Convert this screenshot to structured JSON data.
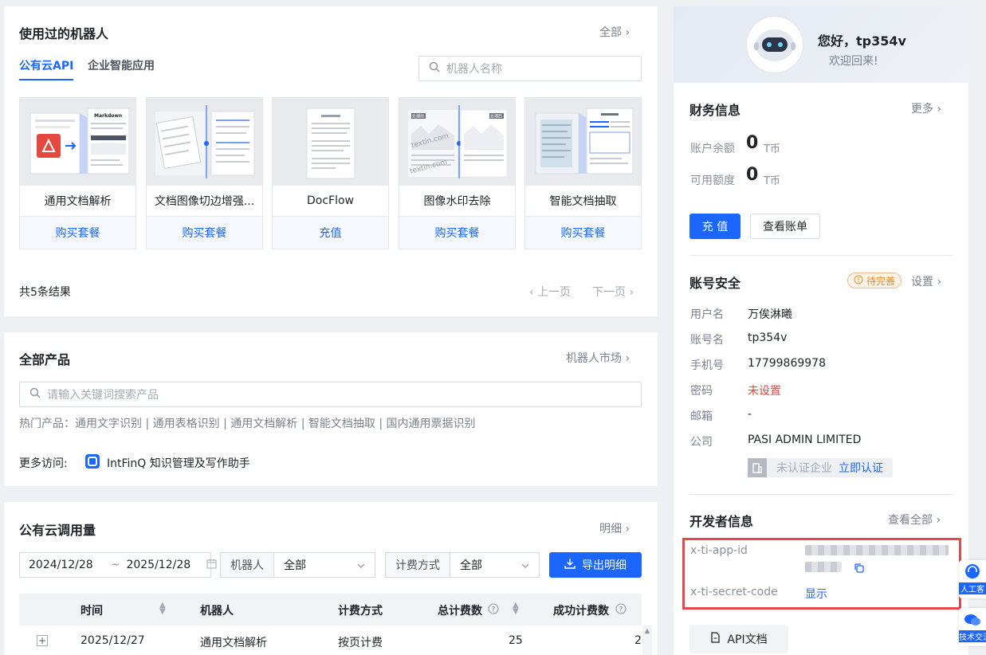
{
  "robots": {
    "title": "使用过的机器人",
    "all_link": "全部",
    "tabs": [
      {
        "label": "公有云API",
        "active": true
      },
      {
        "label": "企业智能应用",
        "active": false
      }
    ],
    "search_placeholder": "机器人名称",
    "items": [
      {
        "name": "通用文档解析",
        "action": "购买套餐"
      },
      {
        "name": "文档图像切边增强...",
        "action": "购买套餐"
      },
      {
        "name": "DocFlow",
        "action": "充值"
      },
      {
        "name": "图像水印去除",
        "action": "购买套餐"
      },
      {
        "name": "智能文档抽取",
        "action": "购买套餐"
      }
    ],
    "thumb_text": {
      "markdown": "Markdown",
      "watermark": "textin.com",
      "tag": "处理前",
      "tag2": "处理后"
    },
    "result_count": "共5条结果",
    "prev": "上一页",
    "next": "下一页"
  },
  "products": {
    "title": "全部产品",
    "market_link": "机器人市场",
    "search_placeholder": "请输入关键词搜索产品",
    "hot_label": "热门产品：",
    "hot_items": [
      "通用文字识别",
      "通用表格识别",
      "通用文档解析",
      "智能文档抽取",
      "国内通用票据识别"
    ],
    "more_label": "更多访问:",
    "more_item": "IntFinQ 知识管理及写作助手"
  },
  "usage": {
    "title": "公有云调用量",
    "detail_link": "明细",
    "date_start": "2024/12/28",
    "date_sep": "~",
    "date_end": "2025/12/28",
    "robot_label": "机器人",
    "robot_value": "全部",
    "billing_label": "计费方式",
    "billing_value": "全部",
    "export_button": "导出明细",
    "columns": [
      "时间",
      "机器人",
      "计费方式",
      "总计费数",
      "成功计费数"
    ],
    "rows": [
      {
        "time": "2025/12/27",
        "robot": "通用文档解析",
        "billing": "按页计费",
        "total": "25",
        "success": "2"
      }
    ]
  },
  "profile": {
    "greeting": "您好，tp354v",
    "welcome": "欢迎回来!"
  },
  "finance": {
    "title": "财务信息",
    "more_link": "更多",
    "balance_label": "账户余额",
    "balance_value": "0",
    "balance_unit": "T币",
    "quota_label": "可用额度",
    "quota_value": "0",
    "quota_unit": "T币",
    "recharge_button": "充 值",
    "bill_button": "查看账单"
  },
  "security": {
    "title": "账号安全",
    "badge": "待完善",
    "settings_link": "设置",
    "fields": [
      {
        "label": "用户名",
        "value": "万俟淋曦"
      },
      {
        "label": "账号名",
        "value": "tp354v"
      },
      {
        "label": "手机号",
        "value": "17799869978"
      },
      {
        "label": "密码",
        "value": "未设置"
      },
      {
        "label": "邮箱",
        "value": "-"
      },
      {
        "label": "公司",
        "value": "PASI ADMIN LIMITED"
      }
    ],
    "cert_status": "未认证企业",
    "cert_link": "立即认证"
  },
  "developer": {
    "title": "开发者信息",
    "view_all_link": "查看全部",
    "app_id_label": "x-ti-app-id",
    "secret_label": "x-ti-secret-code",
    "show_link": "显示",
    "api_doc_button": "API文档"
  },
  "float": {
    "service_label": "人工客",
    "tech_label": "技术交流"
  },
  "colors": {
    "primary": "#1a66ff",
    "warning": "#f08a24",
    "danger": "#f53f3f",
    "highlight_border": "#e5484d"
  }
}
